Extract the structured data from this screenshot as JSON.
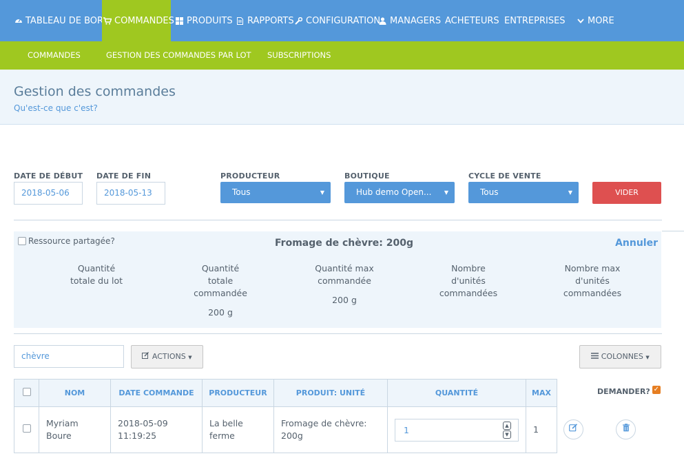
{
  "nav": {
    "items": [
      {
        "label": "TABLEAU DE BORD",
        "icon": "dashboard-icon"
      },
      {
        "label": "COMMANDES",
        "icon": "cart-icon"
      },
      {
        "label": "PRODUITS",
        "icon": "grid-icon"
      },
      {
        "label": "RAPPORTS",
        "icon": "document-icon"
      },
      {
        "label": "CONFIGURATION",
        "icon": "wrench-icon"
      },
      {
        "label": "MANAGERS",
        "icon": "user-icon"
      },
      {
        "label": "ACHETEURS"
      },
      {
        "label": "ENTREPRISES"
      },
      {
        "label": "MORE",
        "icon": "chevron-down-icon"
      }
    ],
    "subitems": [
      "COMMANDES",
      "GESTION DES COMMANDES PAR LOT",
      "SUBSCRIPTIONS"
    ],
    "active_color": "#9fc820",
    "bar_color": "#5498da"
  },
  "page": {
    "title": "Gestion des commandes",
    "help": "Qu'est-ce que c'est?"
  },
  "filters": {
    "start_label": "DATE DE DÉBUT",
    "start_value": "2018-05-06",
    "end_label": "DATE DE FIN",
    "end_value": "2018-05-13",
    "producer_label": "PRODUCTEUR",
    "producer_value": "Tous",
    "shop_label": "BOUTIQUE",
    "shop_value": "Hub demo Open...",
    "cycle_label": "CYCLE DE VENTE",
    "cycle_value": "Tous",
    "clear_label": "VIDER"
  },
  "info": {
    "shared_label": "Ressource partagée?",
    "product_title": "Fromage de chèvre: 200g",
    "cancel_label": "Annuler",
    "stats": [
      {
        "label_lines": [
          "Quantité",
          "totale du lot"
        ],
        "value": ""
      },
      {
        "label_lines": [
          "Quantité",
          "totale",
          "commandée"
        ],
        "value": "200 g"
      },
      {
        "label_lines": [
          "Quantité max",
          "commandée"
        ],
        "value": "200 g"
      },
      {
        "label_lines": [
          "Nombre",
          "d'unités",
          "commandées"
        ],
        "value": ""
      },
      {
        "label_lines": [
          "Nombre max",
          "d'unités",
          "commandées"
        ],
        "value": ""
      }
    ]
  },
  "toolbar": {
    "search_value": "chèvre",
    "actions_label": "ACTIONS",
    "columns_label": "COLONNES"
  },
  "table": {
    "headers": [
      "NOM",
      "DATE COMMANDE",
      "PRODUCTEUR",
      "PRODUIT: UNITÉ",
      "QUANTITÉ",
      "MAX"
    ],
    "demander_label": "DEMANDER?",
    "rows": [
      {
        "name_l1": "Myriam",
        "name_l2": "Boure",
        "date_l1": "2018-05-09",
        "date_l2": "11:19:25",
        "producer_l1": "La belle",
        "producer_l2": "ferme",
        "product_l1": "Fromage de chèvre:",
        "product_l2": "200g",
        "quantity": "1",
        "max": "1"
      }
    ]
  }
}
